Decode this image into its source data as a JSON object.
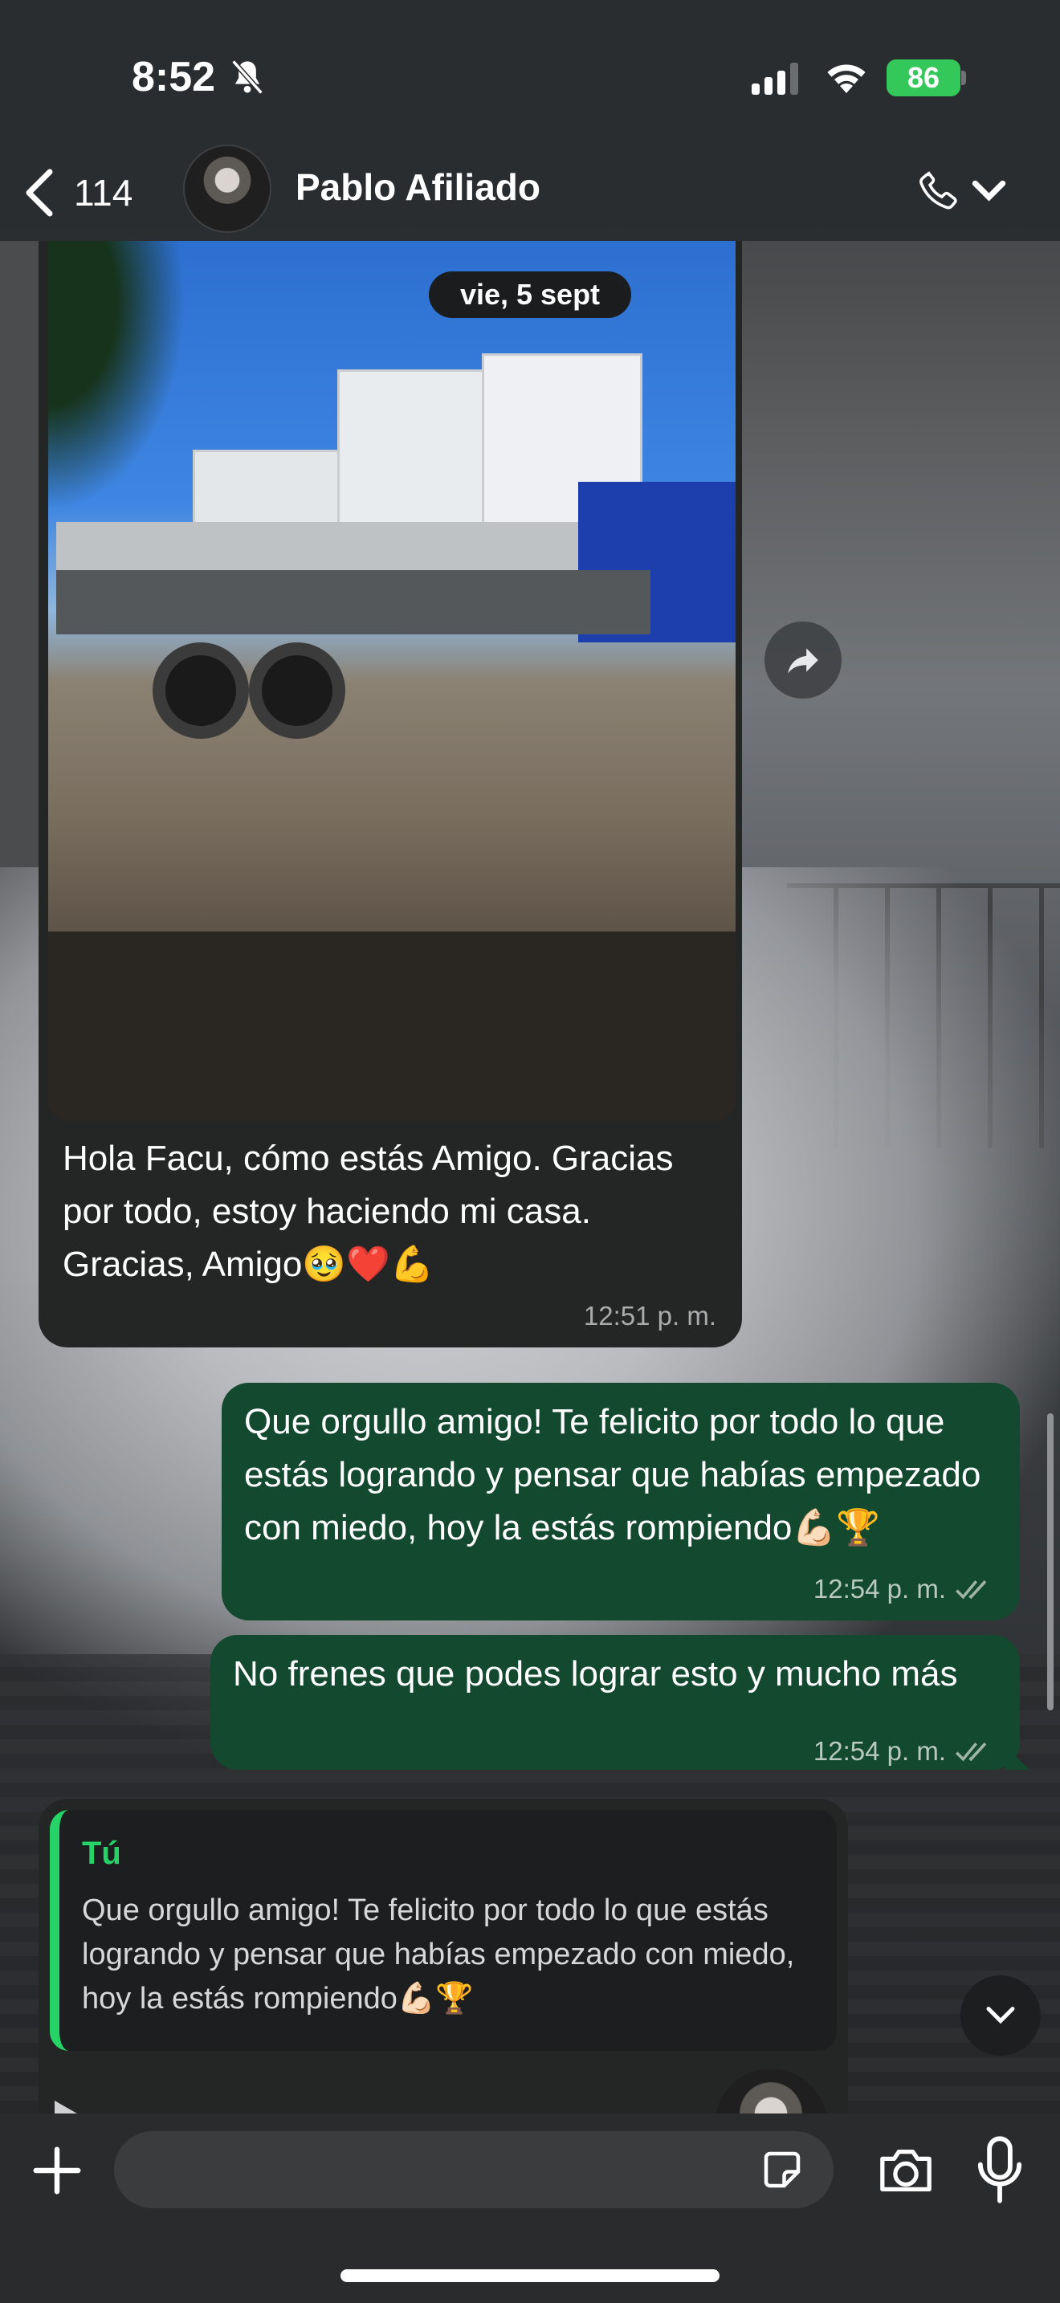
{
  "status_bar": {
    "time": "8:52",
    "battery": "86",
    "icons": [
      "bell-slash-icon",
      "signal-icon",
      "wifi-icon",
      "battery-icon"
    ]
  },
  "header": {
    "back_count": "114",
    "contact_name": "Pablo Afiliado",
    "icons": [
      "chevron-left-icon",
      "phone-icon",
      "chevron-down-icon"
    ]
  },
  "messages": {
    "date_label": "vie, 5 sept",
    "incoming_image": {
      "text": "Hola Facu, cómo estás Amigo. Gracias por todo, estoy haciendo mi casa. Gracias, Amigo🥹❤️💪",
      "time": "12:51 p. m."
    },
    "outgoing": [
      {
        "text": "Que orgullo amigo! Te felicito por todo lo que estás logrando y pensar que habías empezado con miedo, hoy la estás rompiendo💪🏻🏆",
        "time": "12:54 p. m."
      },
      {
        "text": "No frenes que podes lograr esto y mucho más",
        "time": "12:54 p. m."
      }
    ],
    "reply": {
      "quoted_author": "Tú",
      "quoted_text": "Que orgullo amigo! Te felicito por todo lo que estás logrando y pensar que habías empezado con miedo, hoy la estás rompiendo💪🏻🏆"
    }
  },
  "input_bar": {
    "placeholder": "",
    "icons": [
      "plus-icon",
      "sticker-icon",
      "camera-icon",
      "microphone-icon"
    ]
  },
  "colors": {
    "outgoing_bubble": "#12492f",
    "incoming_bubble": "#242626",
    "accent_green": "#25d366",
    "battery_green": "#34c759"
  }
}
